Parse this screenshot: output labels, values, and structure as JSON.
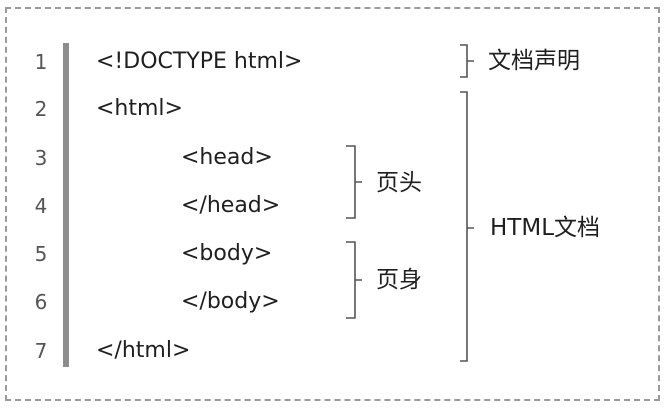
{
  "code_lines": [
    {
      "number": "1",
      "text": "<!DOCTYPE html>"
    },
    {
      "number": "2",
      "text": "<html>"
    },
    {
      "number": "3",
      "text": "<head>"
    },
    {
      "number": "4",
      "text": "</head>"
    },
    {
      "number": "5",
      "text": "<body>"
    },
    {
      "number": "6",
      "text": "</body>"
    },
    {
      "number": "7",
      "text": "</html>"
    }
  ],
  "annotations": {
    "doctype_label": "文档声明",
    "head_label": "页头",
    "body_label": "页身",
    "html_label": "HTML文档"
  }
}
